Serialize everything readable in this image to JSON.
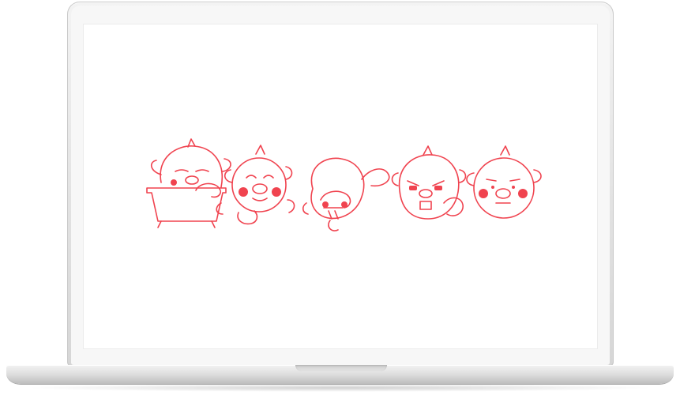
{
  "device": {
    "type": "laptop",
    "finish": "silver"
  },
  "screen": {
    "background": "#ffffff"
  },
  "artwork": {
    "line_color": "#f0434f",
    "figure_count": 5,
    "figures": [
      {
        "pose": "relaxing-in-bathtub"
      },
      {
        "pose": "smiling-waving"
      },
      {
        "pose": "face-planting-rolling"
      },
      {
        "pose": "angry-pointing"
      },
      {
        "pose": "skeptical-frown"
      }
    ]
  }
}
